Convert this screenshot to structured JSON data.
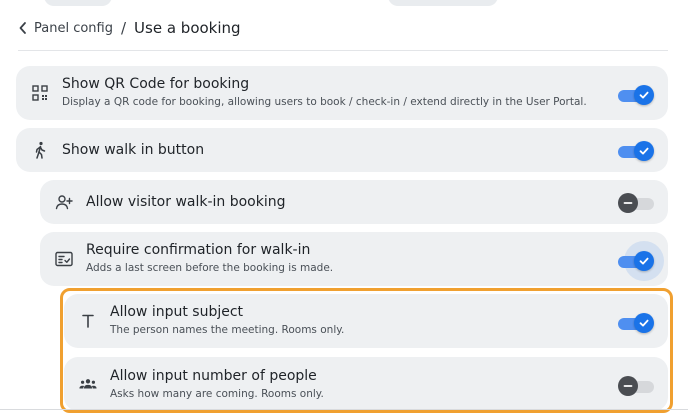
{
  "breadcrumb": {
    "parent": "Panel config",
    "separator": "/",
    "current": "Use a booking"
  },
  "settings": [
    {
      "title": "Show QR Code for booking",
      "description": "Display a QR code for booking, allowing users to book / check-in / extend directly in the User Portal.",
      "enabled": true,
      "icon": "qr-code-icon"
    },
    {
      "title": "Show walk in button",
      "description": "",
      "enabled": true,
      "icon": "walking-person-icon"
    },
    {
      "title": "Allow visitor walk-in booking",
      "description": "",
      "enabled": false,
      "icon": "add-person-icon"
    },
    {
      "title": "Require confirmation for walk-in",
      "description": "Adds a last screen before the booking is made.",
      "enabled": true,
      "icon": "confirmation-icon"
    },
    {
      "title": "Allow input subject",
      "description": "The person names the meeting. Rooms only.",
      "enabled": true,
      "icon": "text-icon"
    },
    {
      "title": "Allow input number of people",
      "description": "Asks how many are coming. Rooms only.",
      "enabled": false,
      "icon": "group-icon"
    }
  ],
  "colors": {
    "accent": "#1a73e8",
    "highlight": "#f0a030",
    "row_background": "#eef0f2"
  }
}
